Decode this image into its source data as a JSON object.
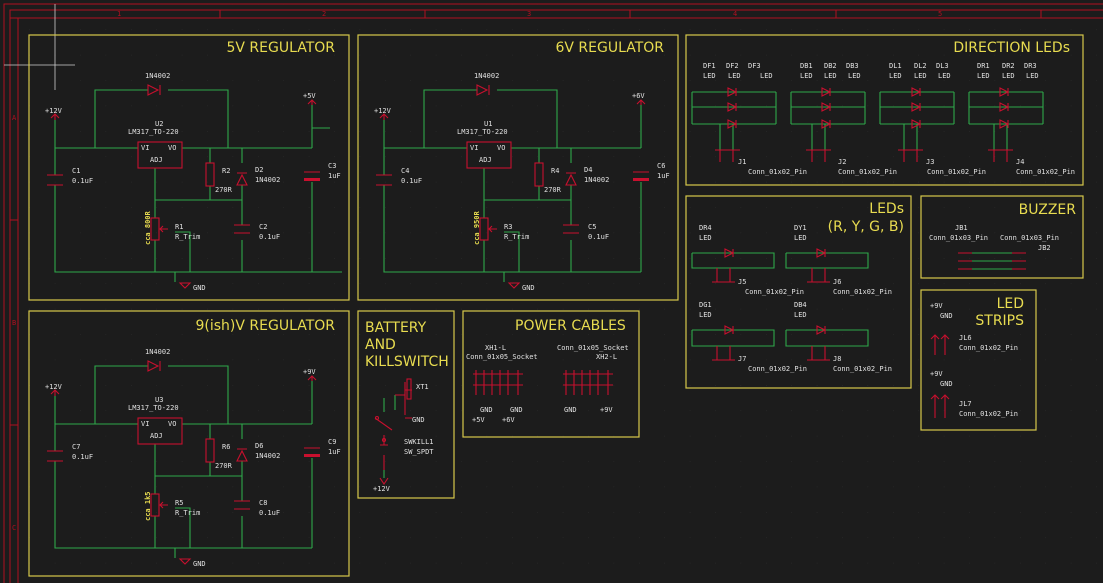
{
  "frame": {
    "columns": [
      "1",
      "2",
      "3",
      "4",
      "5"
    ],
    "rows": [
      "A",
      "B",
      "C"
    ]
  },
  "blocks": {
    "reg5": {
      "title": "5V REGULATOR",
      "diode": "1N4002",
      "reg_ref": "U2",
      "reg_val": "LM317_TO-220",
      "vi": "VI",
      "vo": "VO",
      "adj": "ADJ",
      "in_pwr": "+12V",
      "out_pwr": "+5V",
      "c_in_ref": "C1",
      "c_in_val": "0.1uF",
      "r2_ref": "R2",
      "r2_val": "270R",
      "d2_ref": "D2",
      "d2_val": "1N4002",
      "c3_ref": "C3",
      "c3_val": "1uF",
      "r1_ref": "R1",
      "r1_val": "R_Trim",
      "c2_ref": "C2",
      "c2_val": "0.1uF",
      "trim_note": "cca 800R",
      "gnd": "GND"
    },
    "reg6": {
      "title": "6V REGULATOR",
      "diode": "1N4002",
      "reg_ref": "U1",
      "reg_val": "LM317_TO-220",
      "vi": "VI",
      "vo": "VO",
      "adj": "ADJ",
      "in_pwr": "+12V",
      "out_pwr": "+6V",
      "c_in_ref": "C4",
      "c_in_val": "0.1uF",
      "r2_ref": "R4",
      "r2_val": "270R",
      "d2_ref": "D4",
      "d2_val": "1N4002",
      "c3_ref": "C6",
      "c3_val": "1uF",
      "r1_ref": "R3",
      "r1_val": "R_Trim",
      "c2_ref": "C5",
      "c2_val": "0.1uF",
      "trim_note": "cca 950R",
      "gnd": "GND"
    },
    "reg9": {
      "title": "9(ish)V REGULATOR",
      "diode": "1N4002",
      "reg_ref": "U3",
      "reg_val": "LM317_TO-220",
      "vi": "VI",
      "vo": "VO",
      "adj": "ADJ",
      "in_pwr": "+12V",
      "out_pwr": "+9V",
      "c_in_ref": "C7",
      "c_in_val": "0.1uF",
      "r2_ref": "R6",
      "r2_val": "270R",
      "d2_ref": "D6",
      "d2_val": "1N4002",
      "c3_ref": "C9",
      "c3_val": "1uF",
      "r1_ref": "R5",
      "r1_val": "R_Trim",
      "c2_ref": "C8",
      "c2_val": "0.1uF",
      "trim_note": "cca 1k5",
      "gnd": "GND"
    },
    "battery": {
      "title_1": "BATTERY",
      "title_2": "AND",
      "title_3": "KILLSWITCH",
      "xt": "XT1",
      "sw_ref": "SWKILL1",
      "sw_val": "SW_SPDT",
      "gnd": "GND",
      "pwr": "+12V"
    },
    "cables": {
      "title": "POWER CABLES",
      "xh1_ref": "XH1-L",
      "xh1_val": "Conn_01x05_Socket",
      "xh2_ref": "XH2-L",
      "xh2_val": "Conn_01x05_Socket",
      "labels": [
        "GND",
        "GND",
        "GND",
        "+9V"
      ],
      "labels2": [
        "+5V",
        "+6V"
      ]
    },
    "dir": {
      "title": "DIRECTION LEDs",
      "leds": [
        "DF1",
        "DF2",
        "DF3",
        "DB1",
        "DB2",
        "DB3",
        "DL1",
        "DL2",
        "DL3",
        "DR1",
        "DR2",
        "DR3"
      ],
      "led_val": "LED",
      "conns": [
        "J1",
        "J2",
        "J3",
        "J4"
      ],
      "conn_val": "Conn_01x02_Pin"
    },
    "leds": {
      "title_1": "LEDs",
      "title_2": "(R, Y, G, B)",
      "leds": [
        "DR4",
        "DY1",
        "DG1",
        "DB4"
      ],
      "led_val": "LED",
      "conns": [
        "J5",
        "J6",
        "J7",
        "J8"
      ],
      "conn_val": "Conn_01x02_Pin"
    },
    "buzzer": {
      "title": "BUZZER",
      "jb1": "JB1",
      "jb2": "JB2",
      "conn_val": "Conn_01x03_Pin"
    },
    "strips": {
      "title_1": "LED",
      "title_2": "STRIPS",
      "p1": "+9V",
      "g1": "GND",
      "p2": "+9V",
      "g2": "GND",
      "jl6": "JL6",
      "jl7": "JL7",
      "conn_val": "Conn_01x02_Pin"
    }
  }
}
